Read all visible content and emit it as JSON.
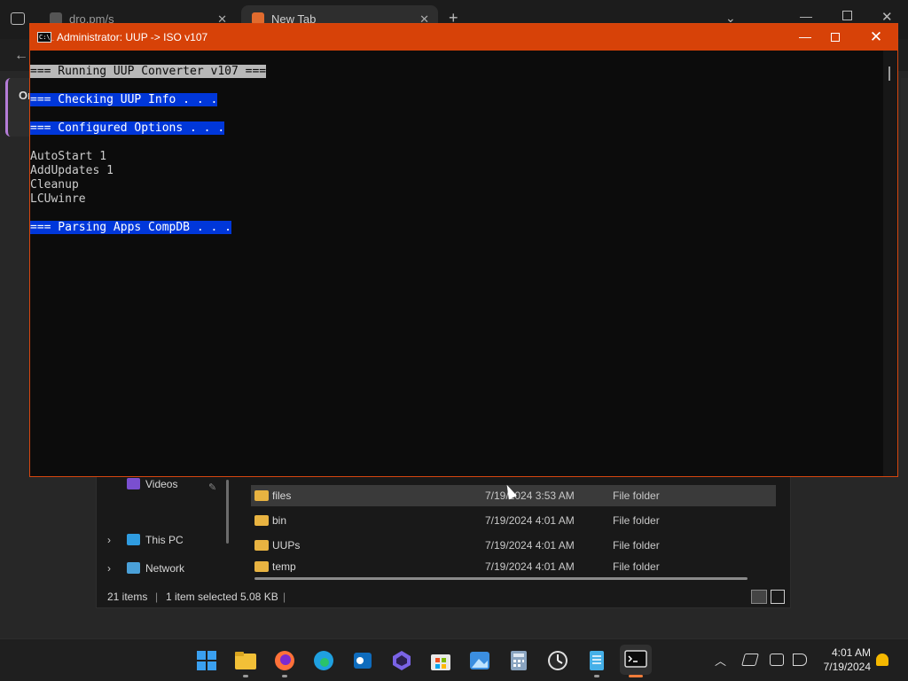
{
  "browser": {
    "tabs": [
      {
        "label": "dro.pm/s"
      },
      {
        "label": "New Tab"
      }
    ],
    "side_card_text": "Or"
  },
  "console": {
    "title": "Administrator:  UUP -> ISO v107",
    "app_icon_text": "C:\\_",
    "lines": [
      {
        "text": "=== Running UUP Converter v107 ===",
        "style": "gray"
      },
      {
        "text": "",
        "style": "plain"
      },
      {
        "text": "=== Checking UUP Info . . .",
        "style": "blue"
      },
      {
        "text": "",
        "style": "plain"
      },
      {
        "text": "=== Configured Options . . .",
        "style": "blue"
      },
      {
        "text": "",
        "style": "plain"
      },
      {
        "text": "AutoStart 1",
        "style": "plain"
      },
      {
        "text": "AddUpdates 1",
        "style": "plain"
      },
      {
        "text": "Cleanup",
        "style": "plain"
      },
      {
        "text": "LCUwinre",
        "style": "plain"
      },
      {
        "text": "",
        "style": "plain"
      },
      {
        "text": "=== Parsing Apps CompDB . . .",
        "style": "blue"
      }
    ],
    "colors": {
      "titlebar": "#d74208",
      "highlight_blue": "#0037da",
      "highlight_gray": "#b8b8b8"
    }
  },
  "explorer": {
    "nav": [
      {
        "label": "Videos",
        "icon": "videos-icon",
        "expandable": false
      },
      {
        "label": "This PC",
        "icon": "this-pc-icon",
        "expandable": true
      },
      {
        "label": "Network",
        "icon": "network-icon",
        "expandable": true
      }
    ],
    "files": [
      {
        "name": "files",
        "date": "7/19/2024 3:53 AM",
        "type": "File folder",
        "selected": true
      },
      {
        "name": "bin",
        "date": "7/19/2024 4:01 AM",
        "type": "File folder",
        "selected": false
      },
      {
        "name": "UUPs",
        "date": "7/19/2024 4:01 AM",
        "type": "File folder",
        "selected": false
      },
      {
        "name": "temp",
        "date": "7/19/2024 4:01 AM",
        "type": "File folder",
        "selected": false
      }
    ],
    "status": {
      "items": "21 items",
      "selected": "1 item selected",
      "size": "5.08 KB"
    }
  },
  "taskbar": {
    "apps": [
      {
        "name": "start-icon",
        "color": "#3aa0f0"
      },
      {
        "name": "file-explorer-icon",
        "color": "#f2c037"
      },
      {
        "name": "firefox-icon",
        "color": "#ff7139"
      },
      {
        "name": "edge-icon",
        "color": "#1fa0e0"
      },
      {
        "name": "outlook-icon",
        "color": "#0f6cbd"
      },
      {
        "name": "copilot-icon",
        "color": "#7a63e6"
      },
      {
        "name": "store-icon",
        "color": "#2b88d8"
      },
      {
        "name": "photos-icon",
        "color": "#3b8ee0"
      },
      {
        "name": "calculator-icon",
        "color": "#8aa4c0"
      },
      {
        "name": "clock-icon",
        "color": "#e0e0e0"
      },
      {
        "name": "notepad-icon",
        "color": "#45b0e8"
      },
      {
        "name": "terminal-icon",
        "color": "#2a2a2a"
      }
    ],
    "time": "4:01 AM",
    "date": "7/19/2024"
  }
}
